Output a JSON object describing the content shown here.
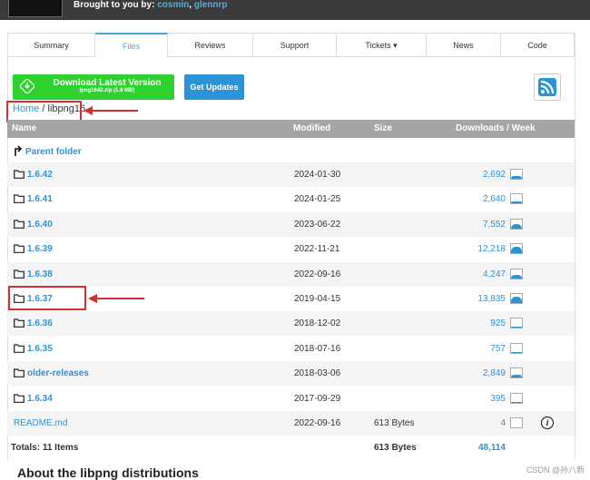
{
  "header": {
    "brought_prefix": "Brought to you by:",
    "maintainers": [
      "cosmin",
      "glennrp"
    ]
  },
  "tabs": [
    {
      "label": "Summary",
      "active": false
    },
    {
      "label": "Files",
      "active": true
    },
    {
      "label": "Reviews",
      "active": false
    },
    {
      "label": "Support",
      "active": false
    },
    {
      "label": "Tickets ▾",
      "active": false
    },
    {
      "label": "News",
      "active": false
    },
    {
      "label": "Code",
      "active": false
    }
  ],
  "download": {
    "label": "Download Latest Version",
    "file": "lpng1642.zip (1.8 MB)"
  },
  "get_updates": "Get Updates",
  "breadcrumb": {
    "home": "Home",
    "sep": "/",
    "current": "libpng16"
  },
  "table": {
    "headers": {
      "name": "Name",
      "modified": "Modified",
      "size": "Size",
      "downloads": "Downloads / Week"
    },
    "parent": "Parent folder",
    "rows": [
      {
        "name": "1.6.42",
        "modified": "2024-01-30",
        "size": "",
        "downloads": "2,692",
        "spark": 0.3
      },
      {
        "name": "1.6.41",
        "modified": "2024-01-25",
        "size": "",
        "downloads": "2,640",
        "spark": 0.25
      },
      {
        "name": "1.6.40",
        "modified": "2023-06-22",
        "size": "",
        "downloads": "7,552",
        "spark": 0.5
      },
      {
        "name": "1.6.39",
        "modified": "2022-11-21",
        "size": "",
        "downloads": "12,218",
        "spark": 0.7
      },
      {
        "name": "1.6.38",
        "modified": "2022-09-16",
        "size": "",
        "downloads": "4,247",
        "spark": 0.35
      },
      {
        "name": "1.6.37",
        "modified": "2019-04-15",
        "size": "",
        "downloads": "13,835",
        "spark": 0.75
      },
      {
        "name": "1.6.36",
        "modified": "2018-12-02",
        "size": "",
        "downloads": "925",
        "spark": 0.1
      },
      {
        "name": "1.6.35",
        "modified": "2018-07-16",
        "size": "",
        "downloads": "757",
        "spark": 0.1
      },
      {
        "name": "older-releases",
        "modified": "2018-03-06",
        "size": "",
        "downloads": "2,849",
        "spark": 0.3
      },
      {
        "name": "1.6.34",
        "modified": "2017-09-29",
        "size": "",
        "downloads": "395",
        "spark": 0.05
      },
      {
        "name": "README.md",
        "modified": "2022-09-16",
        "size": "613 Bytes",
        "downloads": "4",
        "spark": 0.0
      }
    ],
    "totals": {
      "label": "Totals: 11 Items",
      "size": "613 Bytes",
      "downloads": "48,114"
    }
  },
  "about_heading": "About the libpng distributions",
  "watermark": "CSDN @孙八新"
}
